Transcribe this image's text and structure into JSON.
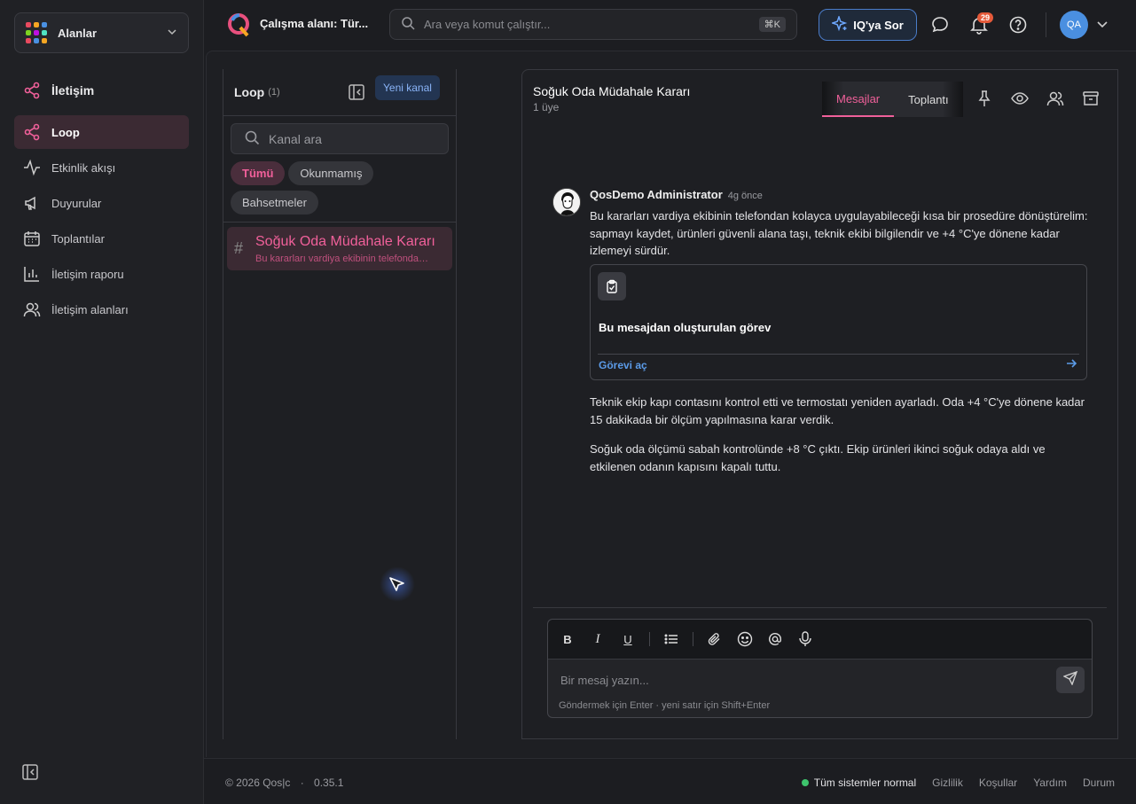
{
  "sidebar": {
    "workspace_switcher": "Alanlar",
    "section_title": "İletişim",
    "items": [
      {
        "label": "Loop",
        "icon": "share-icon",
        "active": true
      },
      {
        "label": "Etkinlik akışı",
        "icon": "activity-icon"
      },
      {
        "label": "Duyurular",
        "icon": "megaphone-icon"
      },
      {
        "label": "Toplantılar",
        "icon": "calendar-icon"
      },
      {
        "label": "İletişim raporu",
        "icon": "bar-chart-icon"
      },
      {
        "label": "İletişim alanları",
        "icon": "users-icon"
      }
    ]
  },
  "topbar": {
    "workspace_name": "Çalışma alanı: Tür...",
    "search_placeholder": "Ara veya komut çalıştır...",
    "search_shortcut": "⌘K",
    "ask_button": "IQ'ya Sor",
    "notification_count": "29",
    "avatar_initials": "QA"
  },
  "channels": {
    "title": "Loop",
    "count": "(1)",
    "new_channel_button": "Yeni kanal",
    "search_placeholder": "Kanal ara",
    "filters": [
      {
        "label": "Tümü",
        "active": true
      },
      {
        "label": "Okunmamış"
      },
      {
        "label": "Bahsetmeler"
      }
    ],
    "list": [
      {
        "name": "Soğuk Oda Müdahale Kararı",
        "snippet": "Bu kararları vardiya ekibinin telefondan kolayca uygulayabileceği kısa bir prosedüre"
      }
    ]
  },
  "conversation": {
    "title": "Soğuk Oda Müdahale Kararı",
    "members": "1 üye",
    "tabs": [
      {
        "label": "Mesajlar",
        "active": true
      },
      {
        "label": "Toplantı"
      }
    ],
    "message": {
      "author": "QosDemo Administrator",
      "time": "4g önce",
      "body1": "Bu kararları vardiya ekibinin telefondan kolayca uygulayabileceği kısa bir prosedüre dönüştürelim: sapmayı kaydet, ürünleri güvenli alana taşı, teknik ekibi bilgilendir ve +4 °C'ye dönene kadar izlemeyi sürdür.",
      "task_card_title": "Bu mesajdan oluşturulan görev",
      "task_card_link": "Görevi aç",
      "body2": "Teknik ekip kapı contasını kontrol etti ve termostatı yeniden ayarladı. Oda +4 °C'ye dönene kadar 15 dakikada bir ölçüm yapılmasına karar verdik.",
      "body3": "Soğuk oda ölçümü sabah kontrolünde +8 °C çıktı. Ekip ürünleri ikinci soğuk odaya aldı ve etkilenen odanın kapısını kapalı tuttu."
    },
    "composer": {
      "placeholder": "Bir mesaj yazın...",
      "hint": "Göndermek için Enter · yeni satır için Shift+Enter"
    }
  },
  "footer": {
    "copyright": "© 2026 Qos|c",
    "version": "0.35.1",
    "status": "Tüm sistemler normal",
    "links": [
      "Gizlilik",
      "Koşullar",
      "Yardım",
      "Durum"
    ]
  },
  "colors": {
    "accent_pink": "#f0609a",
    "link_blue": "#5b9be8",
    "status_green": "#3ec46d",
    "badge_orange": "#e55a3a"
  }
}
